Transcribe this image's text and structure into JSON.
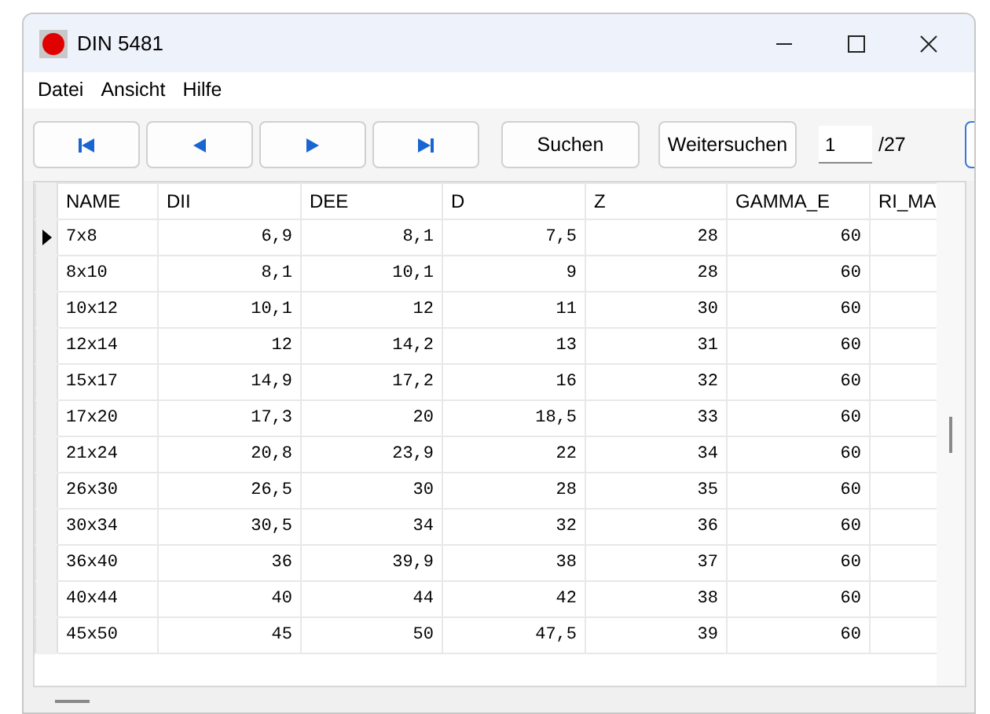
{
  "window": {
    "title": "DIN 5481"
  },
  "menu": [
    "Datei",
    "Ansicht",
    "Hilfe"
  ],
  "nav_buttons": [
    {
      "kind": "first"
    },
    {
      "kind": "prev"
    },
    {
      "kind": "next"
    },
    {
      "kind": "last"
    }
  ],
  "search_buttons": [
    "Suchen",
    "Weitersuchen"
  ],
  "record": {
    "value": "1",
    "total": "/27"
  },
  "table": {
    "columns": [
      "NAME",
      "DII",
      "DEE",
      "D",
      "Z",
      "GAMMA_E",
      "RI_MA"
    ],
    "rows": [
      {
        "selected": true,
        "cells": [
          "7x8",
          "6,9",
          "8,1",
          "7,5",
          "28",
          "60"
        ]
      },
      {
        "selected": false,
        "cells": [
          "8x10",
          "8,1",
          "10,1",
          "9",
          "28",
          "60"
        ]
      },
      {
        "selected": false,
        "cells": [
          "10x12",
          "10,1",
          "12",
          "11",
          "30",
          "60"
        ]
      },
      {
        "selected": false,
        "cells": [
          "12x14",
          "12",
          "14,2",
          "13",
          "31",
          "60"
        ]
      },
      {
        "selected": false,
        "cells": [
          "15x17",
          "14,9",
          "17,2",
          "16",
          "32",
          "60"
        ]
      },
      {
        "selected": false,
        "cells": [
          "17x20",
          "17,3",
          "20",
          "18,5",
          "33",
          "60"
        ]
      },
      {
        "selected": false,
        "cells": [
          "21x24",
          "20,8",
          "23,9",
          "22",
          "34",
          "60"
        ]
      },
      {
        "selected": false,
        "cells": [
          "26x30",
          "26,5",
          "30",
          "28",
          "35",
          "60"
        ]
      },
      {
        "selected": false,
        "cells": [
          "30x34",
          "30,5",
          "34",
          "32",
          "36",
          "60"
        ]
      },
      {
        "selected": false,
        "cells": [
          "36x40",
          "36",
          "39,9",
          "38",
          "37",
          "60"
        ]
      },
      {
        "selected": false,
        "cells": [
          "40x44",
          "40",
          "44",
          "42",
          "38",
          "60"
        ]
      },
      {
        "selected": false,
        "cells": [
          "45x50",
          "45",
          "50",
          "47,5",
          "39",
          "60"
        ]
      }
    ]
  }
}
